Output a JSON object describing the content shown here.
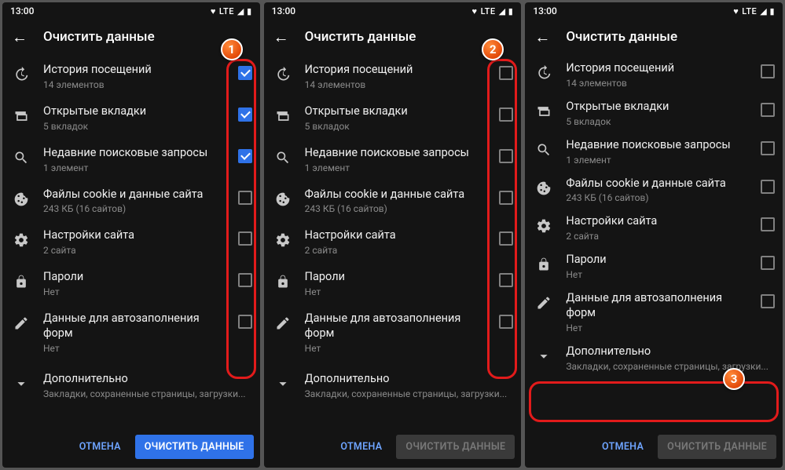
{
  "statusbar": {
    "time": "13:00",
    "net": "LTE"
  },
  "title": "Очистить данные",
  "items": {
    "history": {
      "title": "История посещений",
      "sub": "14 элементов"
    },
    "tabs": {
      "title": "Открытые вкладки",
      "sub": "5 вкладок"
    },
    "search": {
      "title": "Недавние поисковые запросы",
      "sub": "1 элемент"
    },
    "cookies": {
      "title": "Файлы cookie и данные сайта",
      "sub": "243 КБ (16 сайтов)"
    },
    "settings": {
      "title": "Настройки сайта",
      "sub": "2 сайта"
    },
    "passwords": {
      "title": "Пароли",
      "sub": "Нет"
    },
    "autofill": {
      "title": "Данные для автозаполнения форм",
      "sub": "Нет"
    },
    "more": {
      "title": "Дополнительно",
      "sub": "Закладки, сохраненные страницы, загрузки..."
    }
  },
  "buttons": {
    "cancel": "ОТМЕНА",
    "clear": "ОЧИСТИТЬ ДАННЫЕ"
  },
  "badges": {
    "s1": "1",
    "s2": "2",
    "s3": "3"
  }
}
